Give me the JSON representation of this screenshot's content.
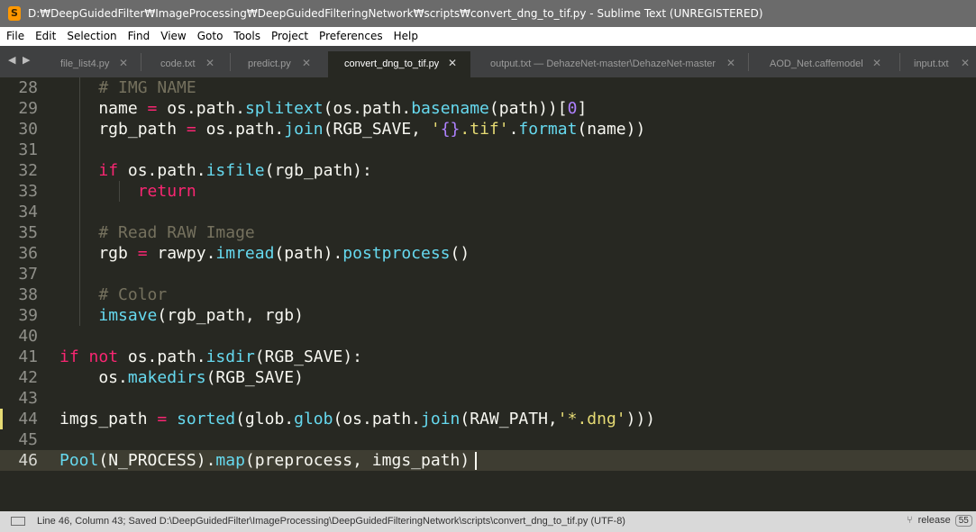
{
  "window": {
    "title": "D:₩DeepGuidedFilter₩ImageProcessing₩DeepGuidedFilteringNetwork₩scripts₩convert_dng_to_tif.py - Sublime Text (UNREGISTERED)"
  },
  "menu": [
    "File",
    "Edit",
    "Selection",
    "Find",
    "View",
    "Goto",
    "Tools",
    "Project",
    "Preferences",
    "Help"
  ],
  "tabs": [
    {
      "label": "file_list4.py"
    },
    {
      "label": "code.txt"
    },
    {
      "label": "predict.py"
    },
    {
      "label": "convert_dng_to_tif.py",
      "active": true
    },
    {
      "label": "output.txt — DehazeNet-master\\DehazeNet-master"
    },
    {
      "label": "AOD_Net.caffemodel"
    },
    {
      "label": "input.txt"
    }
  ],
  "editor": {
    "current_line": 46,
    "modified_line": 44,
    "lines": [
      {
        "num": "28",
        "code": "    # IMG NAME"
      },
      {
        "num": "29",
        "code": "    name = os.path.splitext(os.path.basename(path))[0]"
      },
      {
        "num": "30",
        "code": "    rgb_path = os.path.join(RGB_SAVE, '{}.tif'.format(name))"
      },
      {
        "num": "31",
        "code": ""
      },
      {
        "num": "32",
        "code": "    if os.path.isfile(rgb_path):"
      },
      {
        "num": "33",
        "code": "        return"
      },
      {
        "num": "34",
        "code": ""
      },
      {
        "num": "35",
        "code": "    # Read RAW Image"
      },
      {
        "num": "36",
        "code": "    rgb = rawpy.imread(path).postprocess()"
      },
      {
        "num": "37",
        "code": ""
      },
      {
        "num": "38",
        "code": "    # Color"
      },
      {
        "num": "39",
        "code": "    imsave(rgb_path, rgb)"
      },
      {
        "num": "40",
        "code": ""
      },
      {
        "num": "41",
        "code": "if not os.path.isdir(RGB_SAVE):"
      },
      {
        "num": "42",
        "code": "    os.makedirs(RGB_SAVE)"
      },
      {
        "num": "43",
        "code": ""
      },
      {
        "num": "44",
        "code": "imgs_path = sorted(glob.glob(os.path.join(RAW_PATH,'*.dng')))"
      },
      {
        "num": "45",
        "code": ""
      },
      {
        "num": "46",
        "code": "Pool(N_PROCESS).map(preprocess, imgs_path)"
      }
    ]
  },
  "status": {
    "text": "Line 46, Column 43; Saved D:\\DeepGuidedFilter\\ImageProcessing\\DeepGuidedFilteringNetwork\\scripts\\convert_dng_to_tif.py (UTF-8)",
    "branch": "release",
    "badge": "55"
  },
  "colors": {
    "keyword": "#f92672",
    "function": "#66d9ef",
    "string": "#e6db74",
    "number": "#ae81ff",
    "comment": "#75715e",
    "background": "#272822"
  },
  "icons": {
    "app": "sublime-text-icon",
    "nav": "tab-nav-arrows-icon",
    "close": "close-icon",
    "panel": "panel-toggle-icon",
    "branch": "git-branch-icon"
  }
}
